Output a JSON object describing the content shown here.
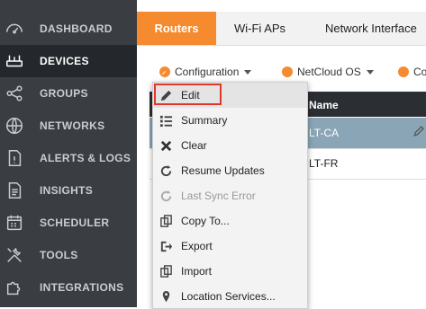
{
  "sidebar": {
    "items": [
      {
        "label": "DASHBOARD",
        "icon": "gauge-icon"
      },
      {
        "label": "DEVICES",
        "icon": "router-icon",
        "active": true
      },
      {
        "label": "GROUPS",
        "icon": "share-icon"
      },
      {
        "label": "NETWORKS",
        "icon": "globe-icon"
      },
      {
        "label": "ALERTS & LOGS",
        "icon": "alert-doc-icon"
      },
      {
        "label": "INSIGHTS",
        "icon": "document-icon"
      },
      {
        "label": "SCHEDULER",
        "icon": "calendar-icon"
      },
      {
        "label": "TOOLS",
        "icon": "tools-icon"
      },
      {
        "label": "INTEGRATIONS",
        "icon": "puzzle-icon"
      }
    ]
  },
  "tabs": [
    {
      "label": "Routers",
      "active": true
    },
    {
      "label": "Wi-Fi APs"
    },
    {
      "label": "Network Interface"
    }
  ],
  "toolbar": {
    "configuration_label": "Configuration",
    "netcloud_label": "NetCloud OS",
    "third_label": "Co"
  },
  "table": {
    "header_name": "Name",
    "rows": [
      {
        "name": "LT-CA",
        "selected": true
      },
      {
        "name": "LT-FR",
        "selected": false
      }
    ]
  },
  "menu": {
    "items": [
      {
        "label": "Edit",
        "icon": "edit-icon",
        "enabled": true,
        "highlight": true
      },
      {
        "label": "Summary",
        "icon": "list-icon",
        "enabled": true
      },
      {
        "label": "Clear",
        "icon": "x-icon",
        "enabled": true
      },
      {
        "label": "Resume Updates",
        "icon": "refresh-icon",
        "enabled": true
      },
      {
        "label": "Last Sync Error",
        "icon": "refresh-icon",
        "enabled": false
      },
      {
        "label": "Copy To...",
        "icon": "copy-icon",
        "enabled": true
      },
      {
        "label": "Export",
        "icon": "export-icon",
        "enabled": true
      },
      {
        "label": "Import",
        "icon": "import-icon",
        "enabled": true
      },
      {
        "label": "Location Services...",
        "icon": "location-pin-icon",
        "enabled": true
      }
    ]
  },
  "colors": {
    "accent": "#f58a2f",
    "sidebar_bg": "#3a3d42",
    "sidebar_active": "#24272b",
    "selected_row": "#8aa6b6",
    "highlight_border": "#e0392b"
  }
}
